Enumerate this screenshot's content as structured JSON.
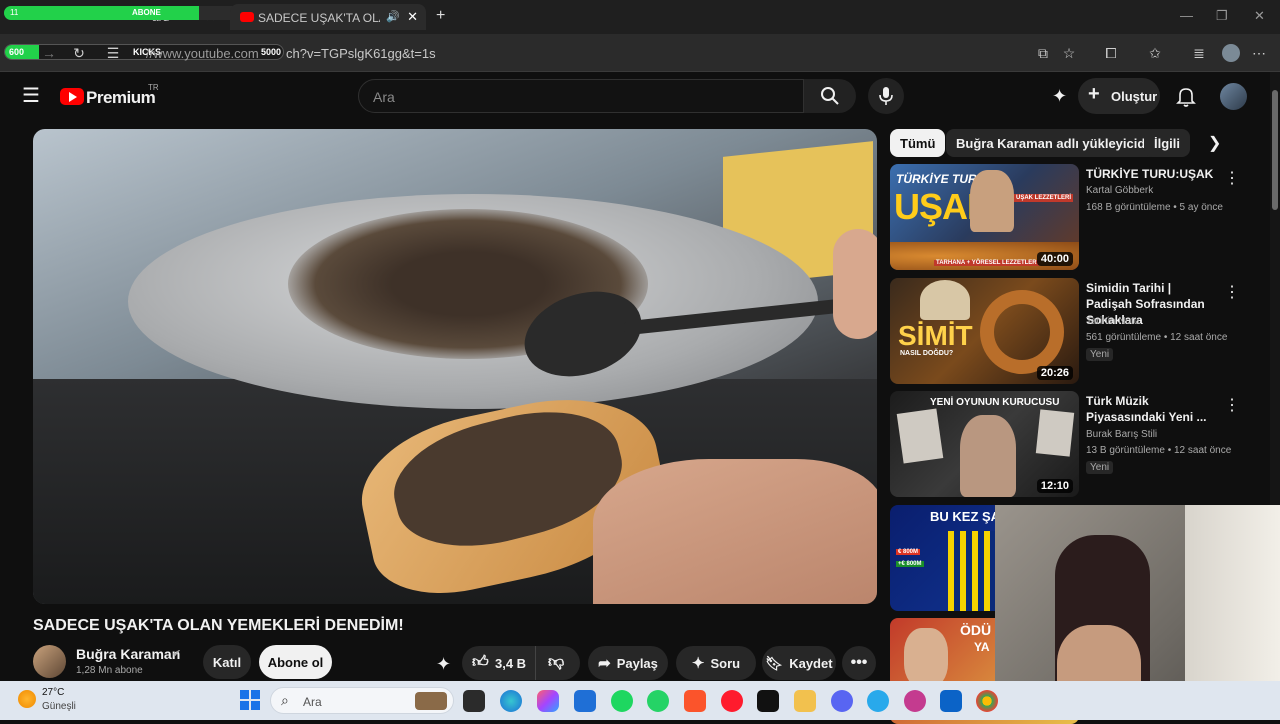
{
  "browser": {
    "tabs": [
      {
        "label": "ard"
      },
      {
        "label": "SADECE UŞAK'TA OLAN YEM"
      }
    ],
    "overlay_bar": {
      "left_num": "11",
      "label": "ABONE",
      "right_num": "20"
    },
    "overlay_bar2": {
      "left_num": "600",
      "label": "KICKS",
      "right_num": "5000"
    },
    "url": "https://www.youtube.com/watch?v=TGPslgK61gg&t=1s",
    "url_display": "//www.youtube.com",
    "url_tail": "ch?v=TGPslgK61gg&t=1s"
  },
  "header": {
    "logo_text": "Premium",
    "region": "TR",
    "search_placeholder": "Ara",
    "create_label": "Oluştur"
  },
  "video": {
    "title": "SADECE UŞAK'TA OLAN YEMEKLERİ DENEDİM!",
    "channel": "Buğra Karaman",
    "subscribers": "1,28 Mn abone",
    "join_label": "Katıl",
    "subscribe_label": "Abone ol",
    "likes": "3,4 B",
    "share_label": "Paylaş",
    "ask_label": "Soru",
    "save_label": "Kaydet"
  },
  "chips": [
    "Tümü",
    "Buğra Karaman adlı yükleyiciden",
    "İlgili"
  ],
  "recommended": [
    {
      "title": "TÜRKİYE TURU:UŞAK",
      "channel": "Kartal Göbberk",
      "meta": "168 B görüntüleme • 5 ay önce",
      "duration": "40:00",
      "badge": "",
      "thumb_text": "UŞAK",
      "thumb_text2": "TÜRKİYE TURU:",
      "thumb_text3": "TARHANA + YÖRESEL LEZZETLER",
      "thumb_text4": "UŞAK LEZZETLERİ"
    },
    {
      "title": "Simidin Tarihi | Padişah Sofrasından Sokaklara",
      "channel": "Tarihin Notu",
      "meta": "561 görüntüleme • 12 saat önce",
      "duration": "20:26",
      "badge": "Yeni",
      "thumb_text": "SİMİT",
      "thumb_text2": "NASIL DOĞDU?"
    },
    {
      "title": "Türk Müzik Piyasasındaki Yeni ...",
      "channel": "Burak Barış Stili",
      "meta": "13 B görüntüleme • 12 saat önce",
      "duration": "12:10",
      "badge": "Yeni",
      "thumb_text": "YENİ OYUNUN KURUCUSU"
    },
    {
      "thumb_text": "BU KEZ ŞAN",
      "thumb_text2": "€ 800M",
      "thumb_text3": "+€ 800M"
    },
    {
      "thumb_text": "ÖDÜ",
      "thumb_text2": "YA"
    }
  ],
  "taskbar": {
    "weather_temp": "27°C",
    "weather_desc": "Güneşli",
    "search_placeholder": "Ara"
  },
  "colors": {
    "yt_red": "#ff0000",
    "bg": "#0f0f0f",
    "subscribe_bg": "#f1f1f1"
  }
}
